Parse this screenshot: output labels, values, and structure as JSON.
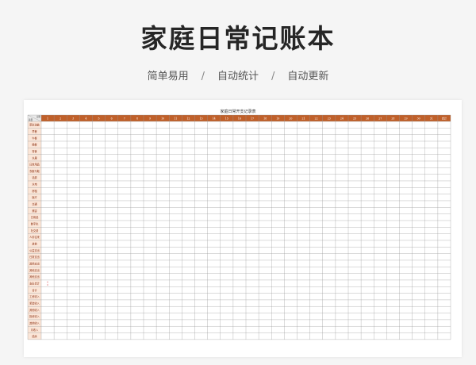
{
  "title": "家庭日常记账本",
  "subtitle": {
    "items": [
      "简单易用",
      "自动统计",
      "自动更新"
    ],
    "separator": "/"
  },
  "sheet": {
    "title": "家庭日常开支记录表",
    "corner_top": "日期",
    "corner_bottom": "项目",
    "days": [
      "1",
      "2",
      "3",
      "4",
      "5",
      "6",
      "7",
      "8",
      "9",
      "10",
      "11",
      "12",
      "13",
      "14",
      "15",
      "16",
      "17",
      "18",
      "19",
      "20",
      "21",
      "22",
      "23",
      "24",
      "25",
      "26",
      "27",
      "28",
      "29",
      "30",
      "31"
    ],
    "total_col": "合计",
    "rows": [
      "菜米油盐",
      "早餐",
      "午餐",
      "晚餐",
      "零食",
      "水果",
      "日常用品",
      "衣服与鞋",
      "话费",
      "水电",
      "房租",
      "医疗",
      "交通",
      "美容",
      "日用品",
      "数字化",
      "社交费",
      "人情往来",
      "其他",
      "公益支出",
      "日常支出",
      "其他支出",
      "其他支出",
      "其他支出",
      "支出合计",
      "合计",
      "工资收入",
      "奖金收入",
      "其他收入",
      "投资收入",
      "其他收入",
      "月收入",
      "结余"
    ],
    "cell_marks": {
      "row": 24,
      "day": 0,
      "values": [
        "0",
        "0"
      ]
    },
    "colors": {
      "header": "#c0602a",
      "header_text": "#ffffff",
      "row_label": "#fbe6d8",
      "row_text": "#8b2f10",
      "grid": "#9a9a9a",
      "mark": "#d03030"
    }
  }
}
